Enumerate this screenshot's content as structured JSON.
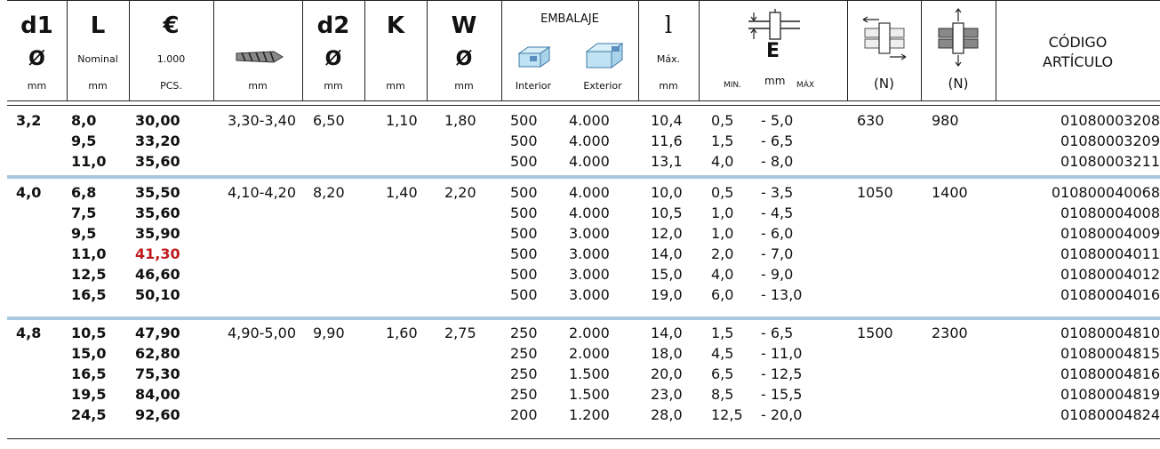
{
  "header": {
    "d1": {
      "label": "d1",
      "sym": "Ø",
      "unit": "mm"
    },
    "L": {
      "label": "L",
      "sub": "Nominal",
      "unit": "mm"
    },
    "price": {
      "label": "€",
      "sub": "1.000",
      "unit": "PCS."
    },
    "drill": {
      "unit": "mm"
    },
    "d2": {
      "label": "d2",
      "sym": "Ø",
      "unit": "mm"
    },
    "K": {
      "label": "K",
      "unit": "mm"
    },
    "W": {
      "label": "W",
      "sym": "Ø",
      "unit": "mm"
    },
    "pack": {
      "label": "EMBALAJE",
      "interior": "Interior",
      "exterior": "Exterior"
    },
    "l": {
      "label": "l",
      "sub": "Máx.",
      "unit": "mm"
    },
    "e": {
      "label": "E",
      "min": "MIN.",
      "unit": "mm",
      "max": "MÁX"
    },
    "shear": {
      "unit": "(N)"
    },
    "tensile": {
      "unit": "(N)"
    },
    "code": {
      "line1": "CÓDIGO",
      "line2": "ARTÍCULO"
    }
  },
  "rows": [
    {
      "d1": "3,2",
      "L": "8,0",
      "price": "30,00",
      "drill": "3,30-3,40",
      "d2": "6,50",
      "K": "1,10",
      "W": "1,80",
      "int": "500",
      "ext": "4.000",
      "l": "10,4",
      "emin": "0,5",
      "emax": "- 5,0",
      "shear": "630",
      "tensile": "980",
      "code": "01080003208"
    },
    {
      "d1": "",
      "L": "9,5",
      "price": "33,20",
      "drill": "",
      "d2": "",
      "K": "",
      "W": "",
      "int": "500",
      "ext": "4.000",
      "l": "11,6",
      "emin": "1,5",
      "emax": "- 6,5",
      "shear": "",
      "tensile": "",
      "code": "01080003209"
    },
    {
      "d1": "",
      "L": "11,0",
      "price": "35,60",
      "drill": "",
      "d2": "",
      "K": "",
      "W": "",
      "int": "500",
      "ext": "4.000",
      "l": "13,1",
      "emin": "4,0",
      "emax": "- 8,0",
      "shear": "",
      "tensile": "",
      "code": "01080003211"
    },
    {
      "d1": "4,0",
      "L": "6,8",
      "price": "35,50",
      "drill": "4,10-4,20",
      "d2": "8,20",
      "K": "1,40",
      "W": "2,20",
      "int": "500",
      "ext": "4.000",
      "l": "10,0",
      "emin": "0,5",
      "emax": "- 3,5",
      "shear": "1050",
      "tensile": "1400",
      "code": "010800040068"
    },
    {
      "d1": "",
      "L": "7,5",
      "price": "35,60",
      "drill": "",
      "d2": "",
      "K": "",
      "W": "",
      "int": "500",
      "ext": "4.000",
      "l": "10,5",
      "emin": "1,0",
      "emax": "- 4,5",
      "shear": "",
      "tensile": "",
      "code": "01080004008"
    },
    {
      "d1": "",
      "L": "9,5",
      "price": "35,90",
      "drill": "",
      "d2": "",
      "K": "",
      "W": "",
      "int": "500",
      "ext": "3.000",
      "l": "12,0",
      "emin": "1,0",
      "emax": "- 6,0",
      "shear": "",
      "tensile": "",
      "code": "01080004009"
    },
    {
      "d1": "",
      "L": "11,0",
      "price": "41,30",
      "drill": "",
      "d2": "",
      "K": "",
      "W": "",
      "int": "500",
      "ext": "3.000",
      "l": "14,0",
      "emin": "2,0",
      "emax": "- 7,0",
      "shear": "",
      "tensile": "",
      "code": "01080004011",
      "highlight": "#c0191d"
    },
    {
      "d1": "",
      "L": "12,5",
      "price": "46,60",
      "drill": "",
      "d2": "",
      "K": "",
      "W": "",
      "int": "500",
      "ext": "3.000",
      "l": "15,0",
      "emin": "4,0",
      "emax": "- 9,0",
      "shear": "",
      "tensile": "",
      "code": "01080004012"
    },
    {
      "d1": "",
      "L": "16,5",
      "price": "50,10",
      "drill": "",
      "d2": "",
      "K": "",
      "W": "",
      "int": "500",
      "ext": "3.000",
      "l": "19,0",
      "emin": "6,0",
      "emax": "- 13,0",
      "shear": "",
      "tensile": "",
      "code": "01080004016"
    },
    {
      "d1": "4,8",
      "L": "10,5",
      "price": "47,90",
      "drill": "4,90-5,00",
      "d2": "9,90",
      "K": "1,60",
      "W": "2,75",
      "int": "250",
      "ext": "2.000",
      "l": "14,0",
      "emin": "1,5",
      "emax": "- 6,5",
      "shear": "1500",
      "tensile": "2300",
      "code": "01080004810"
    },
    {
      "d1": "",
      "L": "15,0",
      "price": "62,80",
      "drill": "",
      "d2": "",
      "K": "",
      "W": "",
      "int": "250",
      "ext": "2.000",
      "l": "18,0",
      "emin": "4,5",
      "emax": "- 11,0",
      "shear": "",
      "tensile": "",
      "code": "01080004815"
    },
    {
      "d1": "",
      "L": "16,5",
      "price": "75,30",
      "drill": "",
      "d2": "",
      "K": "",
      "W": "",
      "int": "250",
      "ext": "1.500",
      "l": "20,0",
      "emin": "6,5",
      "emax": "- 12,5",
      "shear": "",
      "tensile": "",
      "code": "01080004816"
    },
    {
      "d1": "",
      "L": "19,5",
      "price": "84,00",
      "drill": "",
      "d2": "",
      "K": "",
      "W": "",
      "int": "250",
      "ext": "1.500",
      "l": "23,0",
      "emin": "8,5",
      "emax": "- 15,5",
      "shear": "",
      "tensile": "",
      "code": "01080004819"
    },
    {
      "d1": "",
      "L": "24,5",
      "price": "92,60",
      "drill": "",
      "d2": "",
      "K": "",
      "W": "",
      "int": "200",
      "ext": "1.200",
      "l": "28,0",
      "emin": "12,5",
      "emax": "- 20,0",
      "shear": "",
      "tensile": "",
      "code": "01080004824"
    }
  ],
  "colors": {
    "separator": "#a9c7de",
    "box": "#bfe3f2",
    "highlight": "#c0191d"
  }
}
